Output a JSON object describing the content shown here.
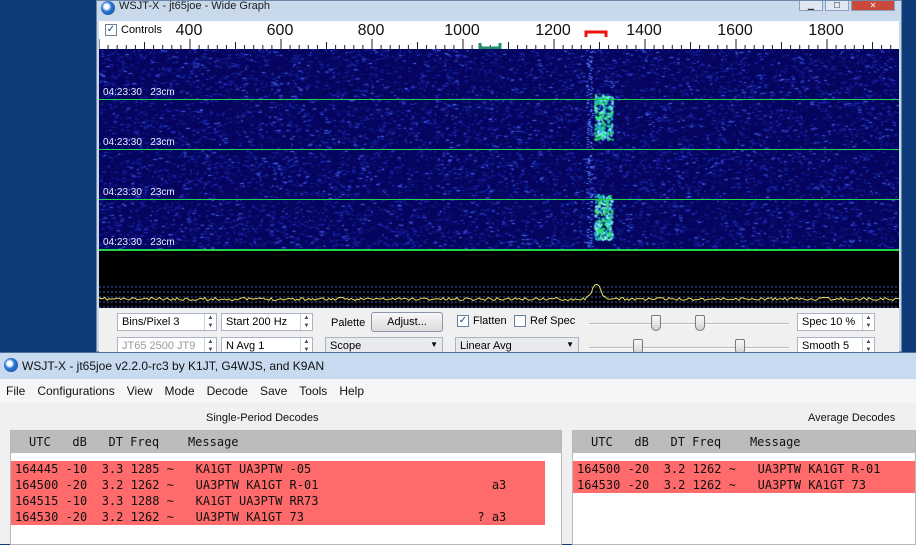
{
  "wide_graph": {
    "title": "WSJT-X - jt65joe - Wide Graph",
    "controls_label": "Controls",
    "freq_ticks": [
      "400",
      "600",
      "800",
      "1000",
      "1200",
      "1400",
      "1600",
      "1800"
    ],
    "waterfall_labels": [
      {
        "time": "04:23:30",
        "band": "23cm"
      },
      {
        "time": "04:23:30",
        "band": "23cm"
      },
      {
        "time": "04:23:30",
        "band": "23cm"
      },
      {
        "time": "04:23:30",
        "band": "23cm"
      }
    ],
    "bins_per_pixel": "Bins/Pixel  3",
    "start": "Start 200 Hz",
    "mode_combo": "JT65  2500  JT9",
    "n_avg": "N Avg 1",
    "palette_label": "Palette",
    "adjust_label": "Adjust...",
    "palette_value": "Scope",
    "flatten_label": "Flatten",
    "ref_spec_label": "Ref Spec",
    "avg_value": "Linear Avg",
    "spec": "Spec 10 %",
    "smooth": "Smooth  5"
  },
  "main": {
    "title": "WSJT-X - jt65joe   v2.2.0-rc3   by K1JT, G4WJS, and K9AN",
    "menu": [
      "File",
      "Configurations",
      "View",
      "Mode",
      "Decode",
      "Save",
      "Tools",
      "Help"
    ],
    "single_title": "Single-Period Decodes",
    "average_title": "Average Decodes",
    "header": "UTC   dB   DT Freq    Message",
    "single_rows": [
      "164445 -10  3.3 1285 ~   KA1GT UA3PTW -05",
      "164500 -20  3.2 1262 ~   UA3PTW KA1GT R-01                        a3",
      "164515 -10  3.3 1288 ~   KA1GT UA3PTW RR73",
      "164530 -20  3.2 1262 ~   UA3PTW KA1GT 73                        ? a3"
    ],
    "average_rows": [
      "164500 -20  3.2 1262 ~   UA3PTW KA1GT R-01",
      "164530 -20  3.2 1262 ~   UA3PTW KA1GT 73"
    ]
  }
}
